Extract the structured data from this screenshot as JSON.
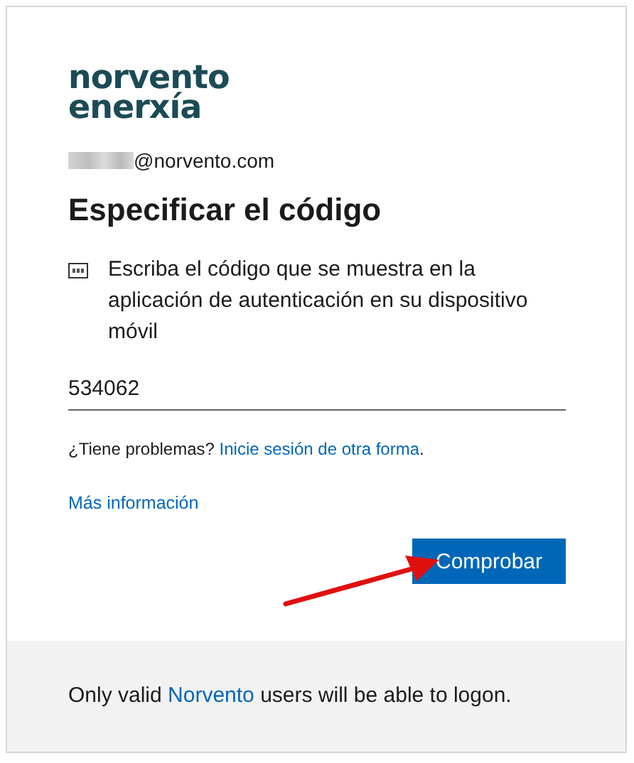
{
  "logo": {
    "lines": [
      "norvento",
      "enerxía"
    ]
  },
  "account": {
    "email_suffix": "@norvento.com",
    "name_blurred": true
  },
  "title": "Especificar el código",
  "instruction": "Escriba el código que se muestra en la aplicación de autenticación en su dispositivo móvil",
  "code_field": {
    "value": "534062"
  },
  "trouble": {
    "text": "¿Tiene problemas?",
    "link": "Inicie sesión de otra forma",
    "end": "."
  },
  "more_info_link": "Más información",
  "verify_button": "Comprobar",
  "annotation": {
    "kind": "arrow"
  },
  "footer": {
    "before": "Only valid",
    "link": "Norvento",
    "after": "users will be able to logon."
  }
}
